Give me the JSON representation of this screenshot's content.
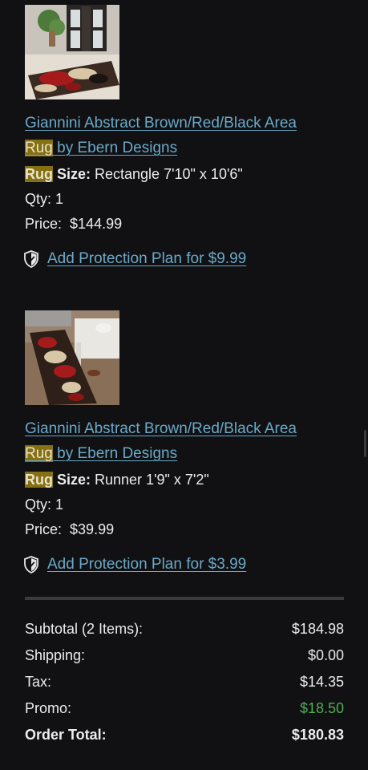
{
  "items": [
    {
      "title_main": "Giannini Abstract Brown/Red/Black Area",
      "title_highlight": "Rug",
      "title_rest": " by Ebern Designs",
      "size_highlight": "Rug",
      "size_label": " Size:",
      "size_value": " Rectangle 7'10\" x 10'6\"",
      "qty": "Qty: 1",
      "price_label": "Price:",
      "price_value": "$144.99",
      "protection": "Add Protection Plan for $9.99",
      "image_icon": "rug-photo-icon"
    },
    {
      "title_main": "Giannini Abstract Brown/Red/Black Area",
      "title_highlight": "Rug",
      "title_rest": " by Ebern Designs",
      "size_highlight": "Rug",
      "size_label": " Size:",
      "size_value": " Runner 1'9\" x 7'2\"",
      "qty": "Qty: 1",
      "price_label": "Price:",
      "price_value": "$39.99",
      "protection": "Add Protection Plan for $3.99",
      "image_icon": "runner-rug-photo-icon"
    }
  ],
  "summary": {
    "subtotal_label": "Subtotal (2 Items):",
    "subtotal_value": "$184.98",
    "shipping_label": "Shipping:",
    "shipping_value": "$0.00",
    "tax_label": "Tax:",
    "tax_value": "$14.35",
    "promo_label": "Promo:",
    "promo_value": "$18.50",
    "total_label": "Order Total:",
    "total_value": "$180.83"
  },
  "colors": {
    "background": "#111113",
    "link": "#6aa9c8",
    "highlight": "#857013",
    "promo_green": "#4fae53"
  }
}
